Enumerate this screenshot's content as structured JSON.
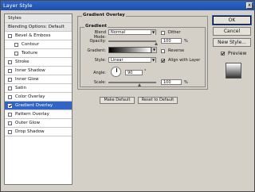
{
  "window": {
    "title": "Layer Style",
    "close_glyph": "x"
  },
  "sidebar": {
    "items": [
      {
        "label": "Styles",
        "type": "header"
      },
      {
        "label": "Blending Options: Default",
        "type": "header"
      },
      {
        "label": "Bevel & Emboss",
        "checked": false
      },
      {
        "label": "Contour",
        "checked": false,
        "indent": true
      },
      {
        "label": "Texture",
        "checked": false,
        "indent": true
      },
      {
        "label": "Stroke",
        "checked": false
      },
      {
        "label": "Inner Shadow",
        "checked": false
      },
      {
        "label": "Inner Glow",
        "checked": false
      },
      {
        "label": "Satin",
        "checked": false
      },
      {
        "label": "Color Overlay",
        "checked": false
      },
      {
        "label": "Gradient Overlay",
        "checked": true,
        "selected": true
      },
      {
        "label": "Pattern Overlay",
        "checked": false
      },
      {
        "label": "Outer Glow",
        "checked": false
      },
      {
        "label": "Drop Shadow",
        "checked": false
      }
    ]
  },
  "panel": {
    "title": "Gradient Overlay",
    "subtitle": "Gradient",
    "blend_mode": {
      "label": "Blend Mode:",
      "value": "Normal"
    },
    "dither": {
      "label": "Dither",
      "checked": false
    },
    "opacity": {
      "label": "Opacity:",
      "value": "100",
      "unit": "%",
      "level": 1.0
    },
    "gradient": {
      "label": "Gradient:",
      "from": "#000000",
      "to": "#ffffff"
    },
    "reverse": {
      "label": "Reverse",
      "checked": false
    },
    "style": {
      "label": "Style:",
      "value": "Linear"
    },
    "align_with_layer": {
      "label": "Align with Layer",
      "checked": true
    },
    "angle": {
      "label": "Angle:",
      "value": "90",
      "unit": "°"
    },
    "scale": {
      "label": "Scale:",
      "value": "100",
      "unit": "%",
      "level": 0.65
    },
    "make_default": "Make Default",
    "reset_default": "Reset to Default"
  },
  "buttons": {
    "ok": "OK",
    "cancel": "Cancel",
    "new_style": "New Style...",
    "preview": {
      "label": "Preview",
      "checked": true
    }
  }
}
